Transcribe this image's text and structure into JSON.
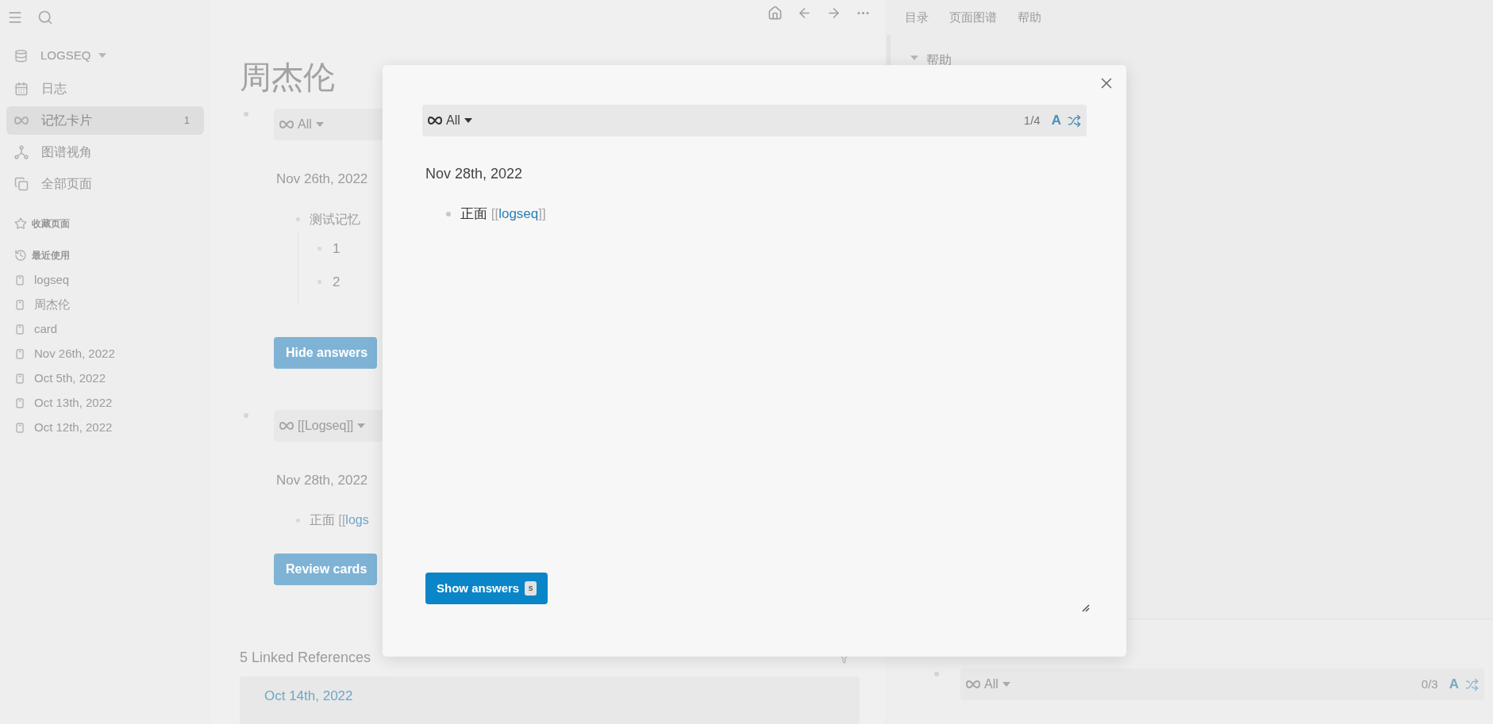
{
  "sidebar": {
    "repo": "LOGSEQ",
    "nav": [
      {
        "label": "日志",
        "selected": false
      },
      {
        "label": "记忆卡片",
        "selected": true,
        "count": "1"
      },
      {
        "label": "图谱视角",
        "selected": false
      },
      {
        "label": "全部页面",
        "selected": false
      }
    ],
    "favorites_heading": "收藏页面",
    "recent_heading": "最近使用",
    "recent": [
      "logseq",
      "周杰伦",
      "card",
      "Nov 26th, 2022",
      "Oct 5th, 2022",
      "Oct 13th, 2022",
      "Oct 12th, 2022"
    ]
  },
  "main": {
    "title": "周杰伦",
    "blocks": [
      {
        "filter": "All",
        "date": "Nov 26th, 2022",
        "item": {
          "text": "测试记忆"
        },
        "children": [
          "1",
          "2"
        ],
        "button": "Hide answers"
      },
      {
        "filter": "[[Logseq]]",
        "date": "Nov 28th, 2022",
        "item": {
          "text": "正面",
          "open": "[[",
          "link": "logs"
        },
        "button": "Review cards"
      }
    ],
    "linked_references": "5 Linked References",
    "reference_date": "Oct 14th, 2022"
  },
  "right_panel": {
    "tabs": [
      {
        "label": "目录"
      },
      {
        "label": "页面图谱"
      },
      {
        "label": "帮助"
      }
    ],
    "help_heading": "帮助",
    "bottom_card": {
      "filter": "All",
      "counter": "0/3",
      "font_toggle": "A"
    }
  },
  "modal": {
    "filter": "All",
    "counter": "1/4",
    "font_toggle": "A",
    "date": "Nov 28th, 2022",
    "item": {
      "text": "正面",
      "open": "[[",
      "link": "logseq",
      "close": "]]"
    },
    "button": "Show answers",
    "shortcut": "s"
  }
}
